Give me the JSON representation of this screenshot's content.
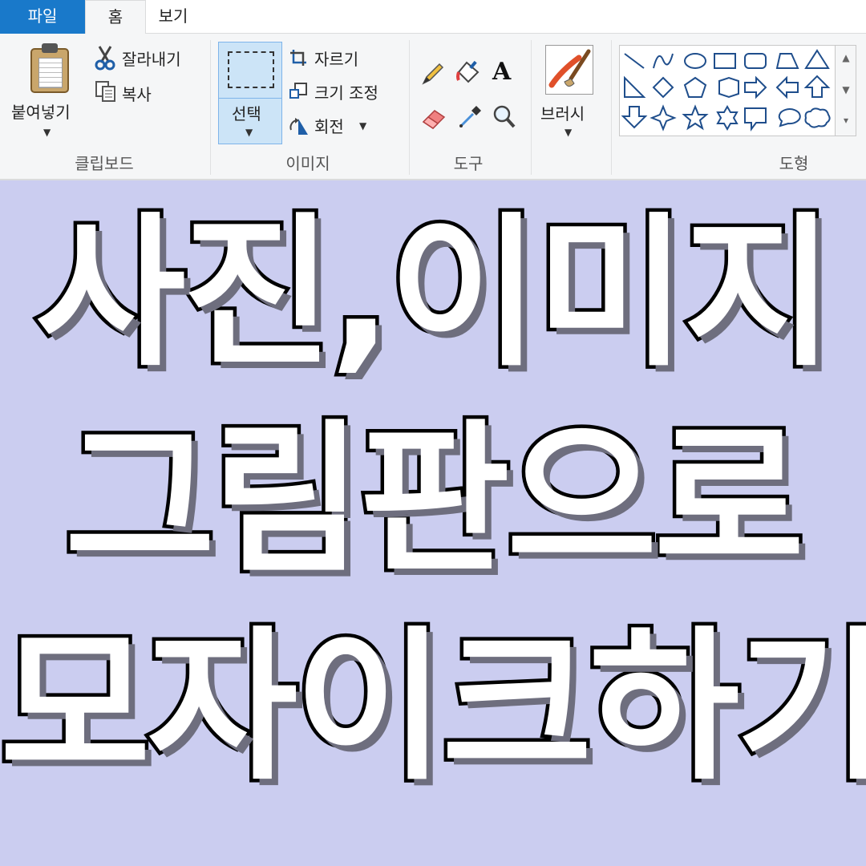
{
  "tabs": {
    "file": "파일",
    "home": "홈",
    "view": "보기"
  },
  "clipboard": {
    "paste_label": "붙여넣기",
    "cut_label": "잘라내기",
    "copy_label": "복사",
    "group_label": "클립보드"
  },
  "image": {
    "select_label": "선택",
    "crop_label": "자르기",
    "resize_label": "크기 조정",
    "rotate_label": "회전",
    "group_label": "이미지"
  },
  "tools": {
    "group_label": "도구",
    "text_tool_glyph": "A"
  },
  "brushes": {
    "label": "브러시"
  },
  "shapes": {
    "group_label": "도형"
  },
  "title_lines": [
    "사진,이미지",
    "그림판으로",
    "모자이크하기"
  ],
  "colors": {
    "file_tab": "#1979ca",
    "background": "#cbcdf0",
    "selected": "#cce4f7",
    "shape_stroke": "#1f4e8c"
  }
}
